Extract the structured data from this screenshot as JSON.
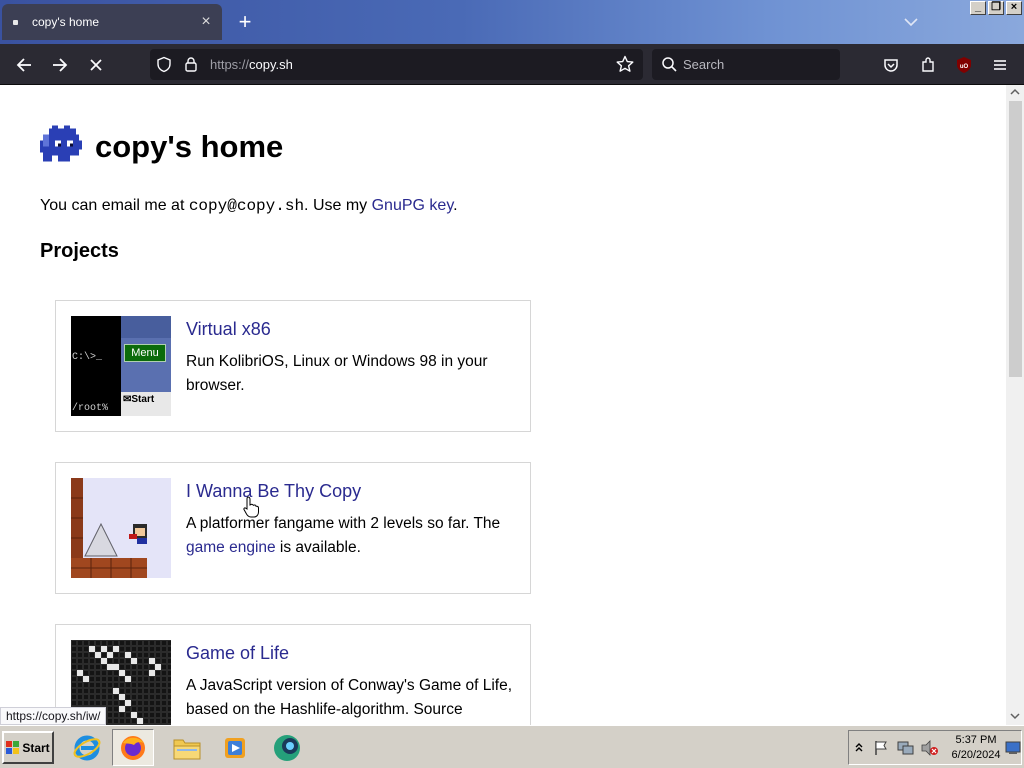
{
  "browser": {
    "tab_title": "copy's home",
    "url_scheme": "https://",
    "url_host": "copy.sh",
    "search_placeholder": "Search"
  },
  "page": {
    "title": "copy's home",
    "email_prefix": "You can email me at ",
    "email": "copy@copy.sh",
    "email_mid": ". Use my ",
    "gnupg_link": "GnuPG key",
    "email_suffix": ".",
    "projects_heading": "Projects",
    "projects": [
      {
        "title": "Virtual x86",
        "desc": "Run KolibriOS, Linux or Windows 98 in your browser.",
        "thumb": {
          "prompt": "C:\\>_",
          "menu": "Menu",
          "root": "/root%",
          "start": "Start"
        }
      },
      {
        "title": "I Wanna Be Thy Copy",
        "desc_prefix": "A platformer fangame with 2 levels so far. The ",
        "desc_link": "game engine",
        "desc_suffix": " is available."
      },
      {
        "title": "Game of Life",
        "desc": "A JavaScript version of Conway's Game of Life, based on the Hashlife-algorithm. Source"
      }
    ]
  },
  "status_link": "https://copy.sh/iw/",
  "taskbar": {
    "start_label": "Start",
    "time": "5:37 PM",
    "date": "6/20/2024"
  },
  "colors": {
    "link": "#2a2a8f",
    "toolbar": "#2b2a33",
    "urlbar": "#1c1b22",
    "taskbar": "#d4d0c8"
  }
}
